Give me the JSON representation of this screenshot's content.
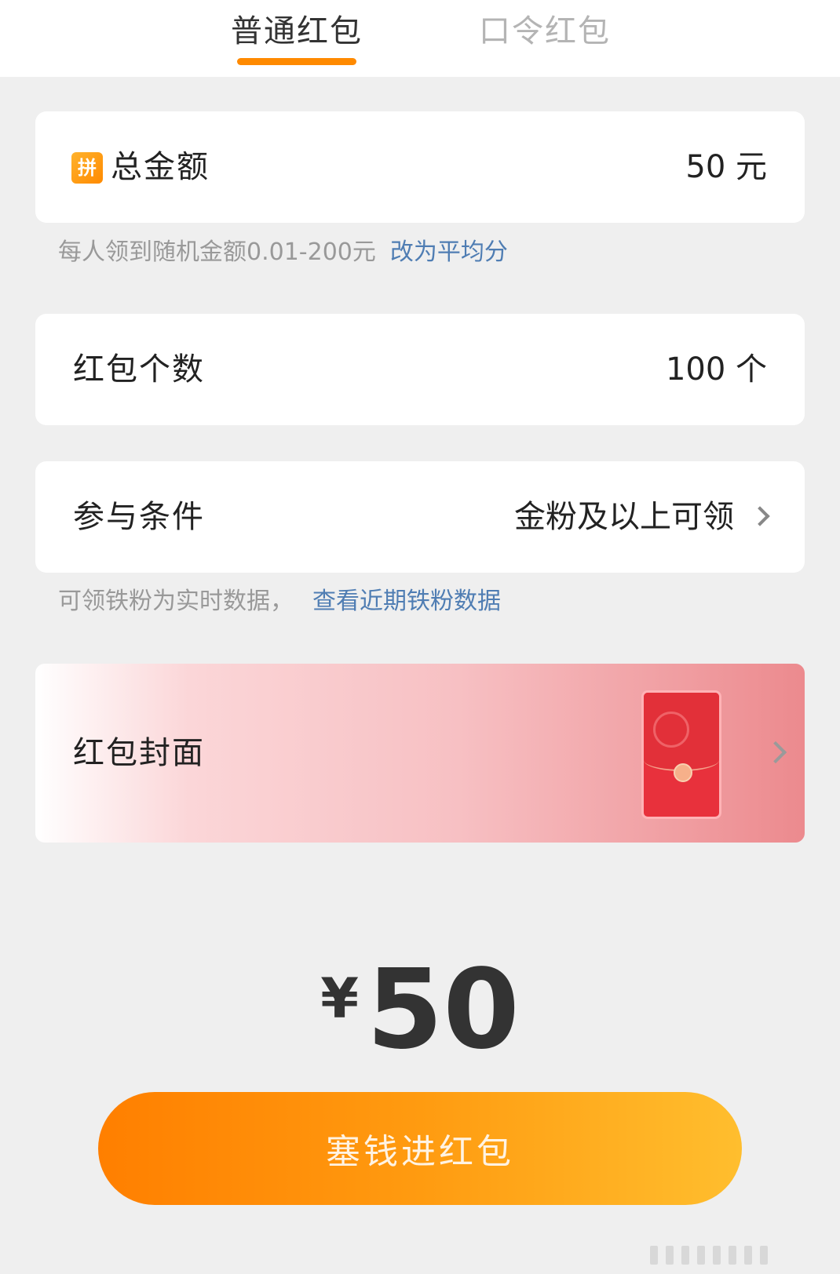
{
  "tabs": [
    {
      "label": "普通红包",
      "active": true
    },
    {
      "label": "口令红包",
      "active": false
    }
  ],
  "total": {
    "badge": "拼",
    "label": "总金额",
    "value": "50 元"
  },
  "random_hint": {
    "text": "每人领到随机金额0.01-200元",
    "link": "改为平均分"
  },
  "count": {
    "label": "红包个数",
    "value": "100 个"
  },
  "condition": {
    "label": "参与条件",
    "value": "金粉及以上可领"
  },
  "fans_hint": {
    "text": "可领铁粉为实时数据，",
    "link": "查看近期铁粉数据"
  },
  "cover": {
    "label": "红包封面"
  },
  "amount": {
    "currency": "¥",
    "value": "50"
  },
  "submit_label": "塞钱进红包",
  "colors": {
    "accent": "#ff8a00",
    "link": "#4f7db3",
    "background": "#efefef"
  }
}
